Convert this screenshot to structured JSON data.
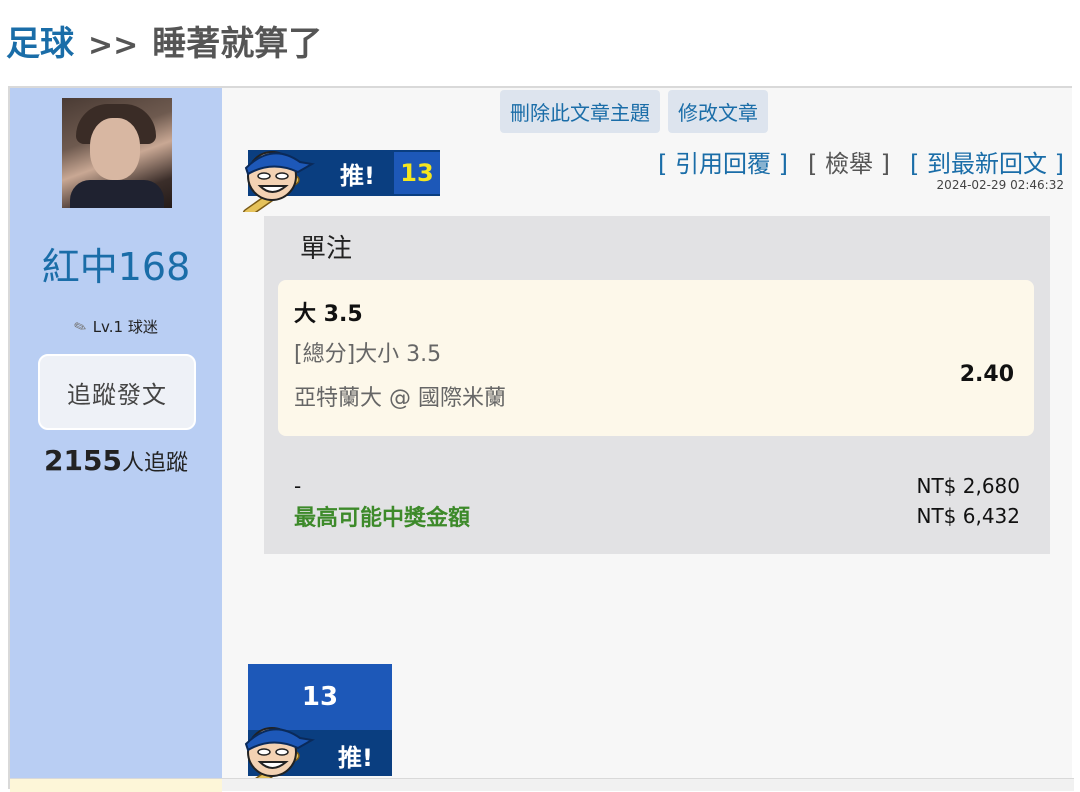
{
  "breadcrumb": {
    "category": "足球",
    "separator": ">>",
    "title": "睡著就算了"
  },
  "author": {
    "name": "紅中168",
    "level": "Lv.1 球迷",
    "follow_label": "追蹤發文",
    "followers_count": "2155",
    "followers_suffix": "人追蹤"
  },
  "actions": {
    "delete_topic": "刪除此文章主題",
    "edit_post": "修改文章"
  },
  "push": {
    "label": "推!",
    "count": "13"
  },
  "links": {
    "quote_reply": "[ 引用回覆 ]",
    "report": "[ 檢舉 ]",
    "latest_reply": "[ 到最新回文 ]"
  },
  "timestamp": "2024-02-29 02:46:32",
  "bet": {
    "type": "單注",
    "pick": "大 3.5",
    "market": "[總分]大小 3.5",
    "match": "亞特蘭大 @ 國際米蘭",
    "odds": "2.40",
    "stake_label": "-",
    "stake_value": "NT$ 2,680",
    "payout_label": "最高可能中獎金額",
    "payout_value": "NT$ 6,432"
  },
  "colors": {
    "link_blue": "#1a6da8",
    "sidebar_bg": "#b9cef3",
    "push_navy": "#0a3e80",
    "push_blue": "#1d58b8",
    "payout_green": "#3d8a2a",
    "count_yellow": "#f5e61f"
  },
  "icons": {
    "mascot": "baseball-mascot-icon",
    "pen": "pencil-icon"
  }
}
